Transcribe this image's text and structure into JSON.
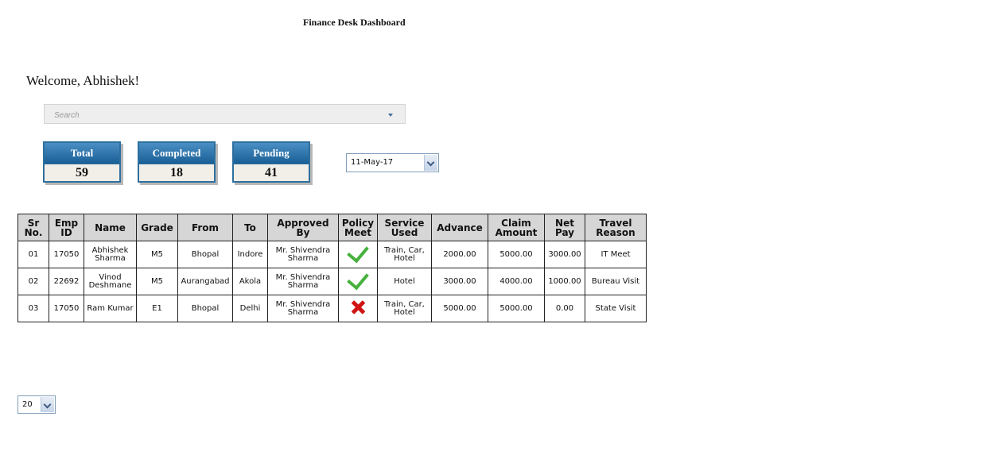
{
  "title": "Finance Desk Dashboard",
  "welcome": "Welcome, Abhishek!",
  "search": {
    "placeholder": "Search",
    "value": ""
  },
  "stats": [
    {
      "label": "Total",
      "value": "59"
    },
    {
      "label": "Completed",
      "value": "18"
    },
    {
      "label": "Pending",
      "value": "41"
    }
  ],
  "date_filter": {
    "selected": "11-May-17"
  },
  "table": {
    "headers": [
      "Sr No.",
      "Emp ID",
      "Name",
      "Grade",
      "From",
      "To",
      "Approved By",
      "Policy Meet",
      "Service Used",
      "Advance",
      "Claim Amount",
      "Net Pay",
      "Travel Reason"
    ],
    "rows": [
      {
        "sr": "01",
        "emp_id": "17050",
        "name": "Abhishek Sharma",
        "grade": "M5",
        "from": "Bhopal",
        "to": "Indore",
        "approved_by": "Mr. Shivendra Sharma",
        "policy_meet": "yes",
        "policy_icon": "check-icon",
        "service": "Train, Car, Hotel",
        "advance": "2000.00",
        "claim": "5000.00",
        "net_pay": "3000.00",
        "reason": "IT Meet"
      },
      {
        "sr": "02",
        "emp_id": "22692",
        "name": "Vinod Deshmane",
        "grade": "M5",
        "from": "Aurangabad",
        "to": "Akola",
        "approved_by": "Mr. Shivendra Sharma",
        "policy_meet": "yes",
        "policy_icon": "check-icon",
        "service": "Hotel",
        "advance": "3000.00",
        "claim": "4000.00",
        "net_pay": "1000.00",
        "reason": "Bureau Visit"
      },
      {
        "sr": "03",
        "emp_id": "17050",
        "name": "Ram Kumar",
        "grade": "E1",
        "from": "Bhopal",
        "to": "Delhi",
        "approved_by": "Mr. Shivendra Sharma",
        "policy_meet": "no",
        "policy_icon": "cross-icon",
        "service": "Train, Car, Hotel",
        "advance": "5000.00",
        "claim": "5000.00",
        "net_pay": "0.00",
        "reason": "State Visit"
      }
    ]
  },
  "page_size": {
    "selected": "20"
  },
  "colors": {
    "accent": "#195f95",
    "check": "#46b13d",
    "cross": "#d01414",
    "header_bg": "#d6d6d6"
  }
}
